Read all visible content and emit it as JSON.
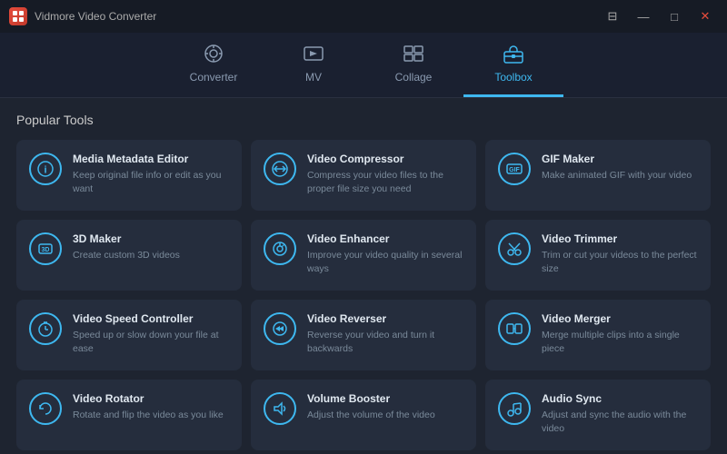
{
  "app": {
    "title": "Vidmore Video Converter",
    "icon_text": "VM"
  },
  "titlebar": {
    "controls": {
      "caption": "⊟",
      "minimize": "—",
      "maximize": "□",
      "close": "✕"
    }
  },
  "nav": {
    "tabs": [
      {
        "id": "converter",
        "label": "Converter",
        "icon": "🔄",
        "active": false
      },
      {
        "id": "mv",
        "label": "MV",
        "icon": "🖼",
        "active": false
      },
      {
        "id": "collage",
        "label": "Collage",
        "icon": "⊞",
        "active": false
      },
      {
        "id": "toolbox",
        "label": "Toolbox",
        "icon": "🧰",
        "active": true
      }
    ]
  },
  "main": {
    "section_title": "Popular Tools",
    "tools": [
      {
        "id": "media-metadata-editor",
        "name": "Media Metadata Editor",
        "desc": "Keep original file info or edit as you want",
        "icon": "ℹ"
      },
      {
        "id": "video-compressor",
        "name": "Video Compressor",
        "desc": "Compress your video files to the proper file size you need",
        "icon": "⇔"
      },
      {
        "id": "gif-maker",
        "name": "GIF Maker",
        "desc": "Make animated GIF with your video",
        "icon": "GIF"
      },
      {
        "id": "3d-maker",
        "name": "3D Maker",
        "desc": "Create custom 3D videos",
        "icon": "3D"
      },
      {
        "id": "video-enhancer",
        "name": "Video Enhancer",
        "desc": "Improve your video quality in several ways",
        "icon": "🎨"
      },
      {
        "id": "video-trimmer",
        "name": "Video Trimmer",
        "desc": "Trim or cut your videos to the perfect size",
        "icon": "✂"
      },
      {
        "id": "video-speed-controller",
        "name": "Video Speed Controller",
        "desc": "Speed up or slow down your file at ease",
        "icon": "⏱"
      },
      {
        "id": "video-reverser",
        "name": "Video Reverser",
        "desc": "Reverse your video and turn it backwards",
        "icon": "⏪"
      },
      {
        "id": "video-merger",
        "name": "Video Merger",
        "desc": "Merge multiple clips into a single piece",
        "icon": "⊕"
      },
      {
        "id": "video-rotator",
        "name": "Video Rotator",
        "desc": "Rotate and flip the video as you like",
        "icon": "↻"
      },
      {
        "id": "volume-booster",
        "name": "Volume Booster",
        "desc": "Adjust the volume of the video",
        "icon": "🔊"
      },
      {
        "id": "audio-sync",
        "name": "Audio Sync",
        "desc": "Adjust and sync the audio with the video",
        "icon": "🎵"
      }
    ]
  }
}
